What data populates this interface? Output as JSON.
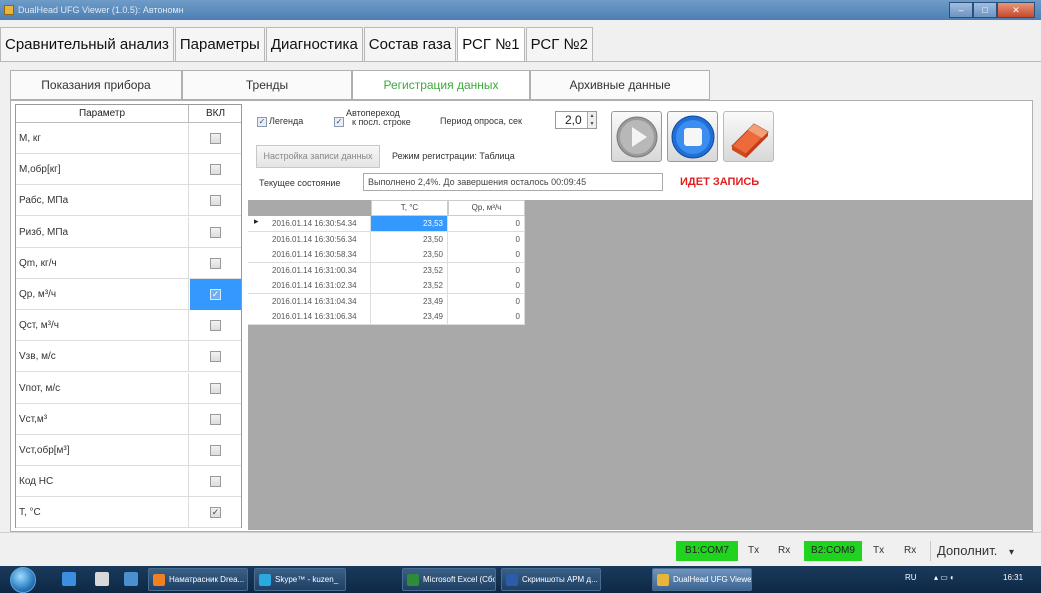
{
  "window": {
    "title": "DualHead UFG Viewer (1.0.5): Автономн"
  },
  "main_tabs": [
    {
      "label": "Сравнительный анализ"
    },
    {
      "label": "Параметры"
    },
    {
      "label": "Диагностика"
    },
    {
      "label": "Состав газа"
    },
    {
      "label": "РСГ №1",
      "active": true
    },
    {
      "label": "РСГ №2"
    }
  ],
  "sub_tabs": [
    {
      "label": "Показания прибора"
    },
    {
      "label": "Тренды"
    },
    {
      "label": "Регистрация данных",
      "active": true
    },
    {
      "label": "Архивные данные"
    }
  ],
  "param_grid": {
    "header_param": "Параметр",
    "header_on": "ВКЛ",
    "rows": [
      {
        "name": "М, кг",
        "checked": false
      },
      {
        "name": "М,обр[кг]",
        "checked": false
      },
      {
        "name": "Рабс, МПа",
        "checked": false
      },
      {
        "name": "Ризб, МПа",
        "checked": false
      },
      {
        "name": "Qm, кг/ч",
        "checked": false
      },
      {
        "name": "Qр, м³/ч",
        "checked": true,
        "selected": true
      },
      {
        "name": "Qст, м³/ч",
        "checked": false
      },
      {
        "name": "Vзв, м/с",
        "checked": false
      },
      {
        "name": "Vпот, м/с",
        "checked": false
      },
      {
        "name": "Vст,м³",
        "checked": false
      },
      {
        "name": "Vст,обр[м³]",
        "checked": false
      },
      {
        "name": "Код НС",
        "checked": false
      },
      {
        "name": "Т, °С",
        "checked": true
      }
    ]
  },
  "controls": {
    "legend_label": "Легенда",
    "legend_checked": true,
    "autoscroll_label_1": "Автопереход",
    "autoscroll_label_2": "к посл. строке",
    "autoscroll_checked": true,
    "poll_label": "Период опроса, сек",
    "poll_value": "2,0",
    "settings_button": "Настройка записи данных",
    "mode_text": "Режим регистрации: Таблица",
    "state_label": "Текущее состояние",
    "state_value": "Выполнено 2,4%. До завершения осталось 00:09:45",
    "recording_flag": "ИДЕТ ЗАПИСЬ"
  },
  "data_grid": {
    "columns": [
      "Т, °С",
      "Qр, м³/ч"
    ],
    "rows": [
      {
        "time": "2016.01.14 16:30:54.34",
        "t": "23,53",
        "q": "0",
        "current": true
      },
      {
        "time": "2016.01.14 16:30:56.34",
        "t": "23,50",
        "q": "0"
      },
      {
        "time": "2016.01.14 16:30:58.34",
        "t": "23,50",
        "q": "0"
      },
      {
        "time": "2016.01.14 16:31:00.34",
        "t": "23,52",
        "q": "0"
      },
      {
        "time": "2016.01.14 16:31:02.34",
        "t": "23,52",
        "q": "0"
      },
      {
        "time": "2016.01.14 16:31:04.34",
        "t": "23,49",
        "q": "0"
      },
      {
        "time": "2016.01.14 16:31:06.34",
        "t": "23,49",
        "q": "0"
      }
    ]
  },
  "status_bar": {
    "port1": "B1:COM7",
    "tx": "Tx",
    "rx": "Rx",
    "port2": "B2:COM9",
    "more": "Дополнит.",
    "more_arrow": "▾",
    "green": "#1fd31f"
  },
  "taskbar": {
    "tasks": [
      {
        "label": "Наматрасник Drea..."
      },
      {
        "label": "Skype™ - kuzen_"
      },
      {
        "label": "Microsoft Excel (Сбо..."
      },
      {
        "label": "Скриншоты АРМ д..."
      },
      {
        "label": "DualHead UFG Viewe...",
        "active": true
      }
    ],
    "lang": "RU",
    "clock": "16:31"
  },
  "colors": {
    "accent_green_text": "#3daa3d",
    "recording_red": "#e02020",
    "selection_blue": "#3399ff"
  }
}
